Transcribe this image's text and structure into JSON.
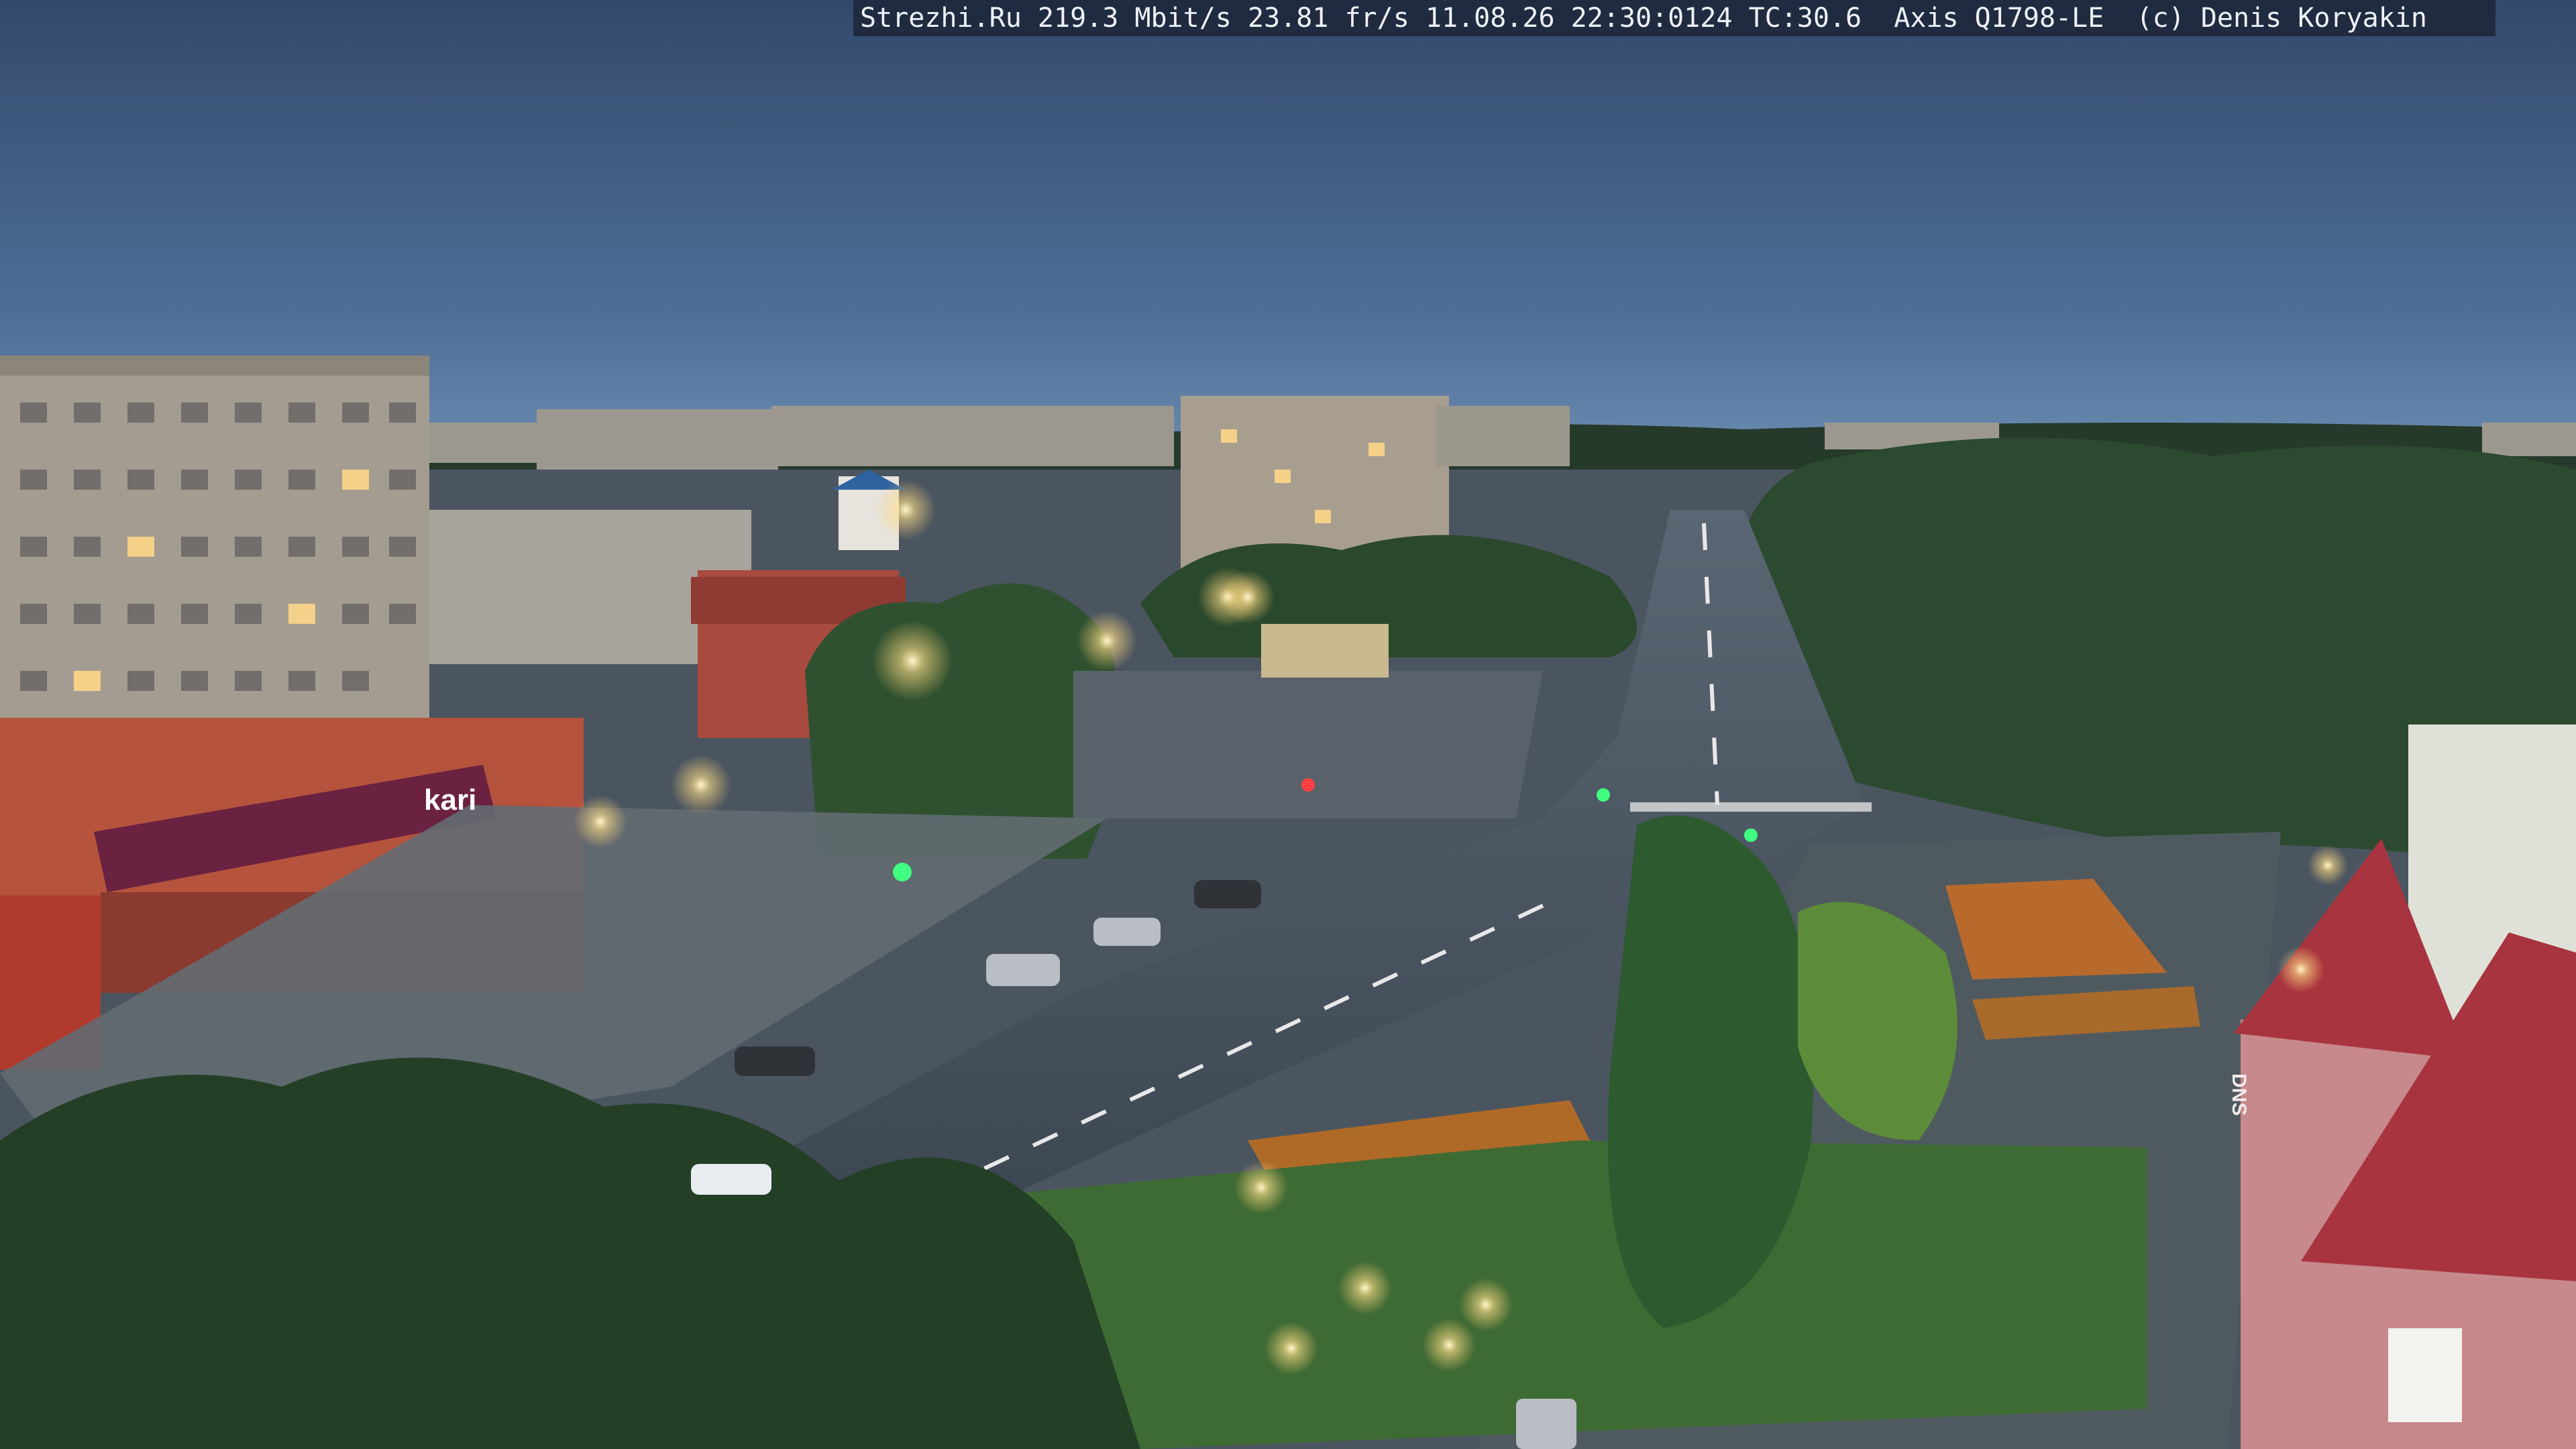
{
  "camera_overlay": {
    "text": "Strezhi.Ru 219.3 Mbit/s 23.81 fr/s 11.08.26 22:30:0124 TC:30.6  Axis Q1798-LE  (c) Denis Koryakin"
  },
  "signs": {
    "kari": "kari",
    "dns": "DNS"
  },
  "colors": {
    "sky_top": "#3b5275",
    "sky_horizon": "#5d7fa3",
    "foliage": "#2c4a2e",
    "road": "#3f4a55",
    "streetlight": "#ffe9a8",
    "storefront": "#b5533d",
    "dns_roof": "#a8343f"
  }
}
